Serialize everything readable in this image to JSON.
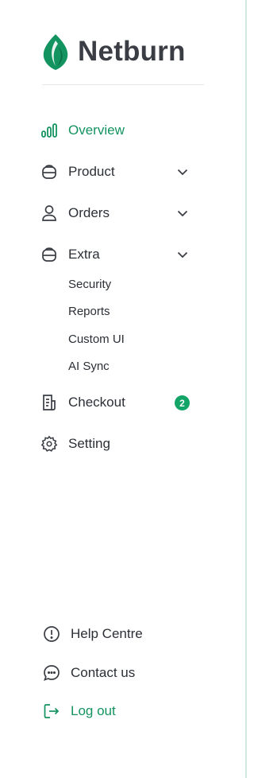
{
  "brand": {
    "name": "Netburn",
    "accent": "#13935f"
  },
  "nav": {
    "overview": {
      "label": "Overview",
      "icon": "bar-chart-icon"
    },
    "product": {
      "label": "Product",
      "icon": "box-icon"
    },
    "orders": {
      "label": "Orders",
      "icon": "user-icon"
    },
    "extra": {
      "label": "Extra",
      "icon": "box-icon",
      "subitems": [
        "Security",
        "Reports",
        "Custom UI",
        "AI Sync"
      ]
    },
    "checkout": {
      "label": "Checkout",
      "icon": "receipt-icon",
      "badge": "2"
    },
    "setting": {
      "label": "Setting",
      "icon": "gear-icon"
    }
  },
  "footer": {
    "help": {
      "label": "Help Centre",
      "icon": "alert-circle-icon"
    },
    "contact": {
      "label": "Contact us",
      "icon": "chat-icon"
    },
    "logout": {
      "label": "Log out",
      "icon": "logout-icon"
    }
  }
}
